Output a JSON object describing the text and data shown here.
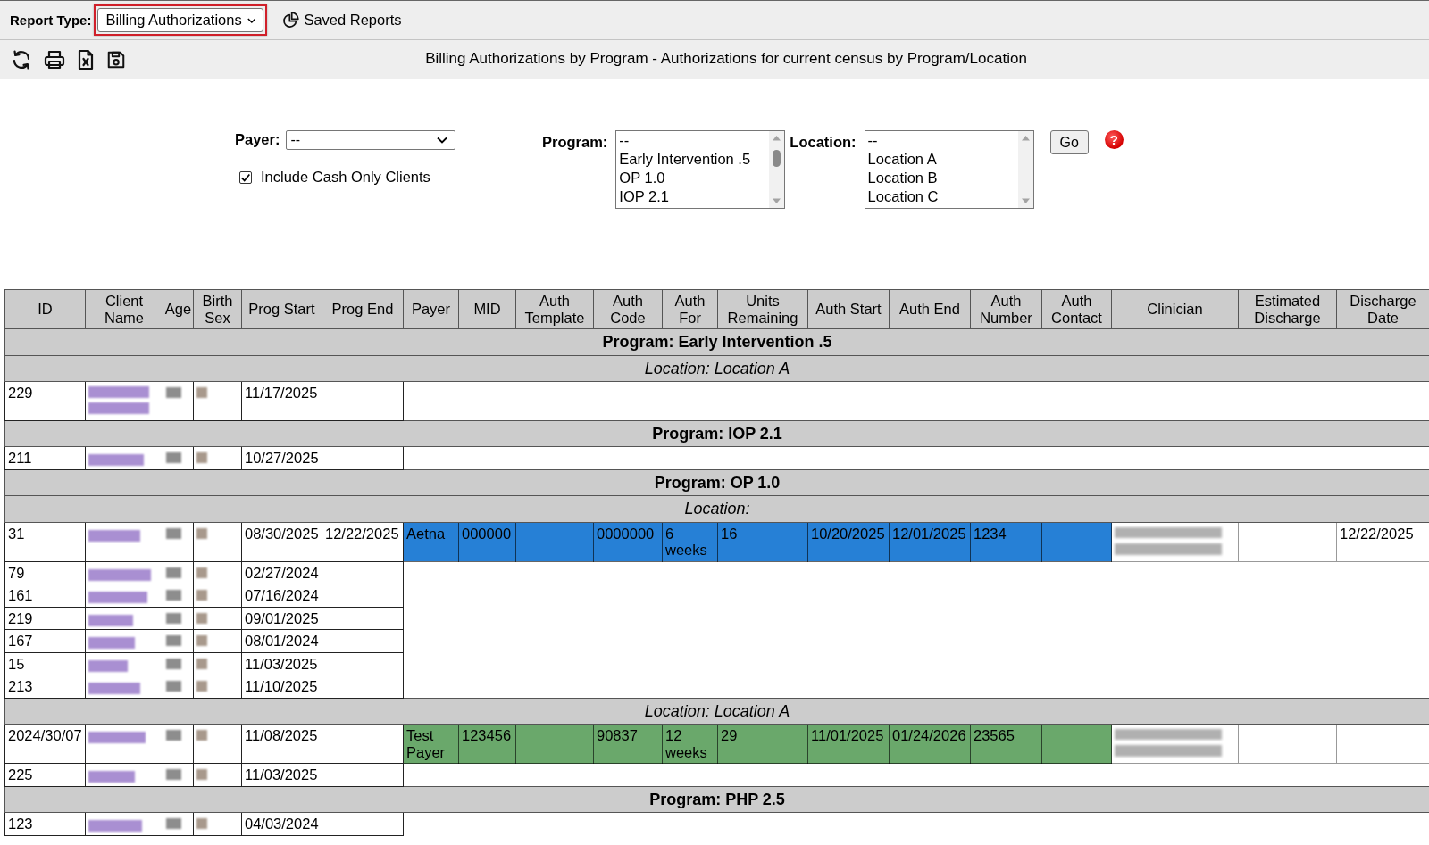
{
  "report_bar": {
    "label": "Report Type:",
    "value": "Billing Authorizations",
    "saved_reports": "Saved Reports"
  },
  "toolbar": {
    "title": "Billing Authorizations by Program - Authorizations for current census by Program/Location"
  },
  "filters": {
    "payer": {
      "label": "Payer:",
      "value": "--"
    },
    "cash_only": {
      "label": "Include Cash Only Clients",
      "checked": true
    },
    "program": {
      "label": "Program:",
      "options": [
        {
          "text": "--",
          "selected": false
        },
        {
          "text": "Early Intervention .5",
          "selected": false
        },
        {
          "text": "OP 1.0",
          "selected": false
        },
        {
          "text": "IOP 2.1",
          "selected": false
        }
      ]
    },
    "location": {
      "label": "Location:",
      "options": [
        {
          "text": "--",
          "selected": false
        },
        {
          "text": "Location A",
          "selected": false
        },
        {
          "text": "Location B",
          "selected": false
        },
        {
          "text": "Location C",
          "selected": false
        }
      ]
    },
    "go_button": "Go",
    "help_button": "?"
  },
  "table": {
    "columns": [
      "ID",
      "Client Name",
      "Age",
      "Birth Sex",
      "Prog Start",
      "Prog End",
      "Payer",
      "MID",
      "Auth Template",
      "Auth Code",
      "Auth For",
      "Units Remaining",
      "Auth Start",
      "Auth End",
      "Auth Number",
      "Auth Contact",
      "Clinician",
      "Estimated Discharge",
      "Discharge Date"
    ],
    "rows": [
      {
        "kind": "program",
        "text": "Program: Early Intervention .5"
      },
      {
        "kind": "location",
        "text": "Location: Location A"
      },
      {
        "kind": "client",
        "id": "229",
        "prog_start": "11/17/2025"
      },
      {
        "kind": "program",
        "text": "Program: IOP 2.1"
      },
      {
        "kind": "client",
        "id": "211",
        "prog_start": "10/27/2025"
      },
      {
        "kind": "program",
        "text": "Program: OP 1.0"
      },
      {
        "kind": "location",
        "text": "Location:"
      },
      {
        "kind": "client",
        "id": "31",
        "prog_start": "08/30/2025",
        "prog_end": "12/22/2025",
        "auth": {
          "color": "#2680d6",
          "payer": "Aetna",
          "mid": "000000",
          "auth_code": "0000000",
          "auth_for": "6 weeks",
          "units_remaining": "16",
          "auth_start": "10/20/2025",
          "auth_end": "12/01/2025",
          "auth_number": "1234"
        },
        "discharge_date": "12/22/2025"
      },
      {
        "kind": "client",
        "id": "79",
        "prog_start": "02/27/2024"
      },
      {
        "kind": "client",
        "id": "161",
        "prog_start": "07/16/2024"
      },
      {
        "kind": "client",
        "id": "219",
        "prog_start": "09/01/2025"
      },
      {
        "kind": "client",
        "id": "167",
        "prog_start": "08/01/2024"
      },
      {
        "kind": "client",
        "id": "15",
        "prog_start": "11/03/2025"
      },
      {
        "kind": "client",
        "id": "213",
        "prog_start": "11/10/2025"
      },
      {
        "kind": "location",
        "text": "Location: Location A"
      },
      {
        "kind": "client",
        "id": "2024/30/07",
        "prog_start": "11/08/2025",
        "auth": {
          "color": "#6aa86b",
          "payer": "Test Payer",
          "mid": "123456",
          "auth_code": "90837",
          "auth_for": "12 weeks",
          "units_remaining": "29",
          "auth_start": "11/01/2025",
          "auth_end": "01/24/2026",
          "auth_number": "23565"
        }
      },
      {
        "kind": "client",
        "id": "225",
        "prog_start": "11/03/2025"
      },
      {
        "kind": "program",
        "text": "Program: PHP 2.5"
      },
      {
        "kind": "client",
        "id": "123",
        "prog_start": "04/03/2024"
      }
    ]
  }
}
